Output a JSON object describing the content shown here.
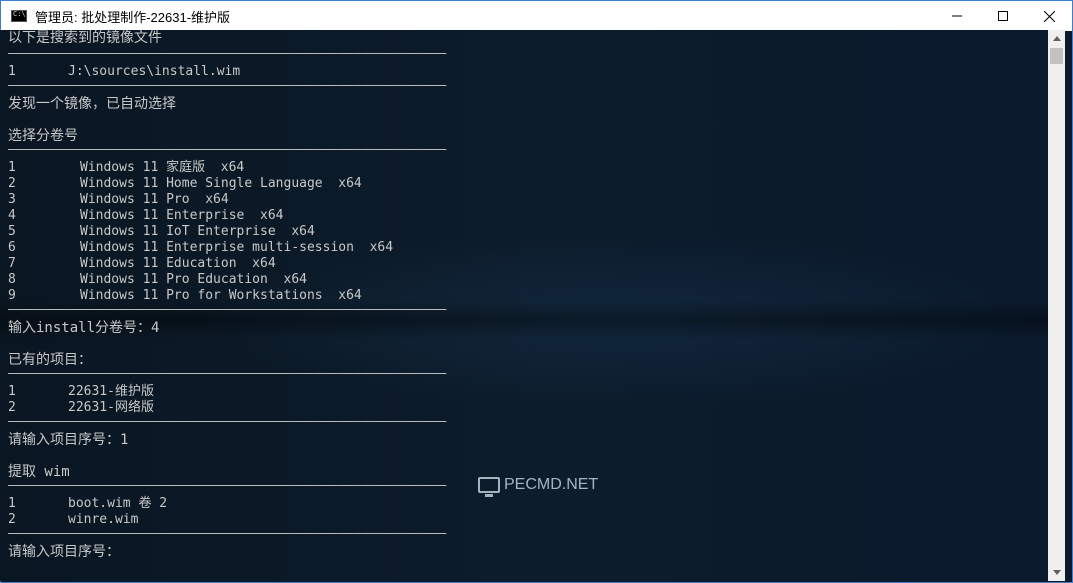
{
  "window": {
    "title": "管理员:  批处理制作-22631-维护版",
    "controls": {
      "minimize": "—",
      "maximize": "☐",
      "close": "✕"
    }
  },
  "console": {
    "separator": "————————————————————————————————————————————————————————",
    "search_header": "以下是搜索到的镜像文件",
    "images": [
      {
        "index": "1",
        "path": "J:\\sources\\install.wim"
      }
    ],
    "auto_select": "发现一个镜像，已自动选择",
    "volume_header": "选择分卷号",
    "volumes": [
      {
        "index": "1",
        "name": "Windows 11 家庭版  x64"
      },
      {
        "index": "2",
        "name": "Windows 11 Home Single Language  x64"
      },
      {
        "index": "3",
        "name": "Windows 11 Pro  x64"
      },
      {
        "index": "4",
        "name": "Windows 11 Enterprise  x64"
      },
      {
        "index": "5",
        "name": "Windows 11 IoT Enterprise  x64"
      },
      {
        "index": "6",
        "name": "Windows 11 Enterprise multi-session  x64"
      },
      {
        "index": "7",
        "name": "Windows 11 Education  x64"
      },
      {
        "index": "8",
        "name": "Windows 11 Pro Education  x64"
      },
      {
        "index": "9",
        "name": "Windows 11 Pro for Workstations  x64"
      }
    ],
    "volume_prompt": "输入install分卷号：4",
    "projects_header": "已有的项目：",
    "projects": [
      {
        "index": "1",
        "name": "22631-维护版"
      },
      {
        "index": "2",
        "name": "22631-网络版"
      }
    ],
    "project_prompt": "请输入项目序号：1",
    "extract_header": "提取 wim",
    "wims": [
      {
        "index": "1",
        "name": "boot.wim 卷 2"
      },
      {
        "index": "2",
        "name": "winre.wim"
      }
    ],
    "final_prompt": "请输入项目序号："
  },
  "watermark": {
    "text": "PECMD.NET"
  }
}
